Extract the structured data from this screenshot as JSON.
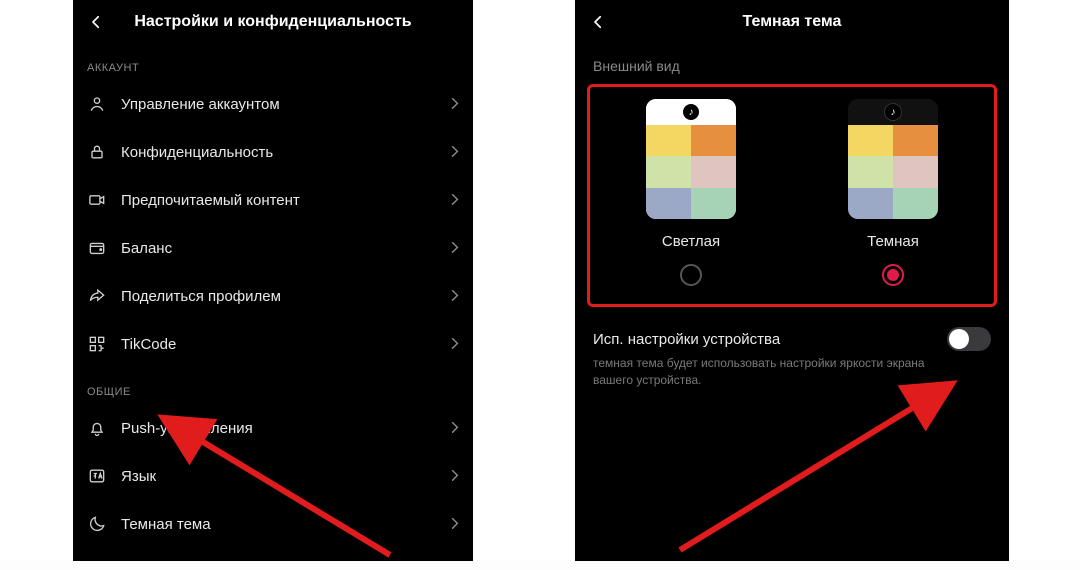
{
  "left": {
    "title": "Настройки и конфиденциальность",
    "sectionAccount": "АККАУНТ",
    "items_account": [
      {
        "label": "Управление аккаунтом",
        "icon": "user-icon"
      },
      {
        "label": "Конфиденциальность",
        "icon": "lock-icon"
      },
      {
        "label": "Предпочитаемый контент",
        "icon": "video-icon"
      },
      {
        "label": "Баланс",
        "icon": "wallet-icon"
      },
      {
        "label": "Поделиться профилем",
        "icon": "share-icon"
      },
      {
        "label": "TikCode",
        "icon": "qrcode-icon"
      }
    ],
    "sectionGeneral": "ОБЩИЕ",
    "items_general": [
      {
        "label": "Push-уведомления",
        "icon": "bell-icon"
      },
      {
        "label": "Язык",
        "icon": "lang-icon"
      },
      {
        "label": "Темная тема",
        "icon": "moon-icon"
      }
    ]
  },
  "right": {
    "title": "Темная тема",
    "appearance": "Внешний вид",
    "light_label": "Светлая",
    "dark_label": "Темная",
    "selected": "dark",
    "toggle_title": "Исп. настройки устройства",
    "toggle_desc": "темная тема будет использовать настройки яркости экрана вашего устройства.",
    "toggle_on": false
  },
  "colors": {
    "highlight": "#e11c1c",
    "accent": "#e11c4a"
  }
}
